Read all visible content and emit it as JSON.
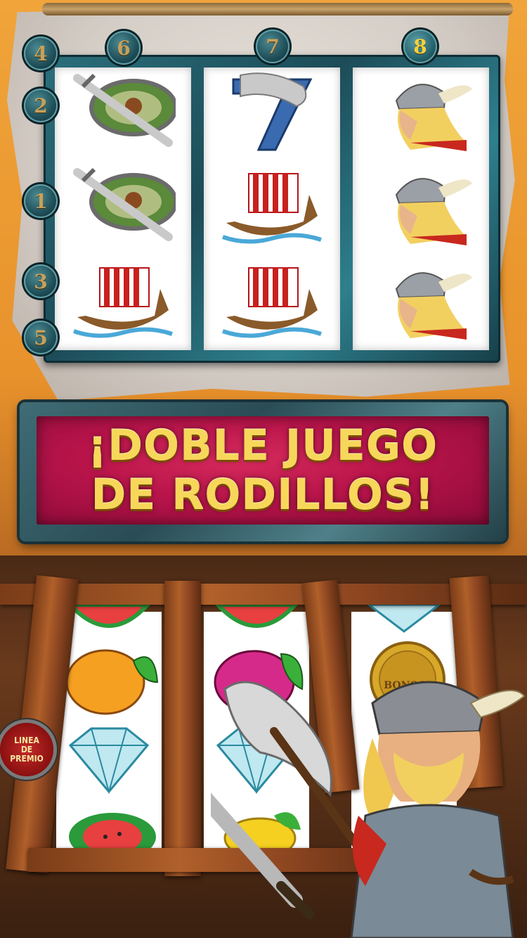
{
  "paylines": {
    "top": [
      "4",
      "6",
      "7",
      "8"
    ],
    "left": [
      "2",
      "1",
      "3",
      "5"
    ],
    "active": "8"
  },
  "upper_reels": {
    "reel1": [
      "shield-sword",
      "shield-sword",
      "viking-ship"
    ],
    "reel2": [
      "axe-seven",
      "viking-ship",
      "viking-ship"
    ],
    "reel3": [
      "viking-head",
      "viking-head",
      "viking-head"
    ]
  },
  "banner": {
    "line1": "¡DOBLE JUEGO",
    "line2": "DE RODILLOS!"
  },
  "lower_reels": {
    "reel1": [
      "watermelon",
      "orange",
      "diamond",
      "watermelon"
    ],
    "reel2": [
      "watermelon",
      "plum",
      "diamond",
      "lemon"
    ],
    "reel3": [
      "diamond",
      "bonus-coin"
    ]
  },
  "bonus_coin_label": "BONOS",
  "payline_button": {
    "line1": "LINEA",
    "line2": "DE",
    "line3": "PREMIO"
  },
  "colors": {
    "banner_red": "#b8144a",
    "banner_text": "#f7d75a",
    "frame_teal": "#2b6f7c",
    "badge_text": "#c7a05a",
    "active_badge_text": "#f5d03a"
  }
}
